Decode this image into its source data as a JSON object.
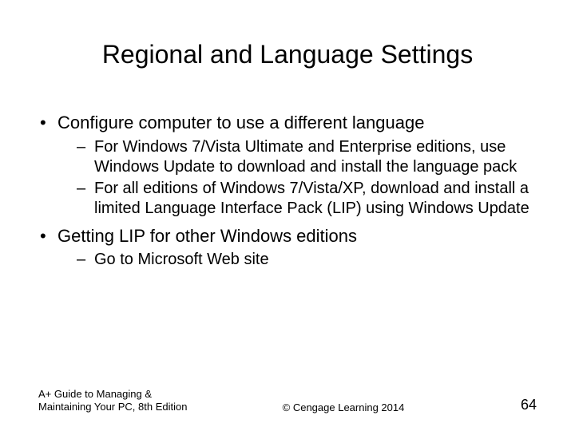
{
  "title": "Regional and Language Settings",
  "bullets": [
    {
      "text": "Configure computer to use a different language",
      "sub": [
        "For Windows 7/Vista Ultimate and Enterprise editions, use Windows Update to download and install the language pack",
        "For all editions of Windows 7/Vista/XP, download and install a limited Language Interface Pack (LIP) using Windows Update"
      ]
    },
    {
      "text": "Getting LIP for other Windows editions",
      "sub": [
        "Go to Microsoft Web site"
      ]
    }
  ],
  "footer": {
    "left": "A+ Guide to Managing & Maintaining Your PC, 8th Edition",
    "center": "© Cengage Learning  2014",
    "right": "64"
  }
}
